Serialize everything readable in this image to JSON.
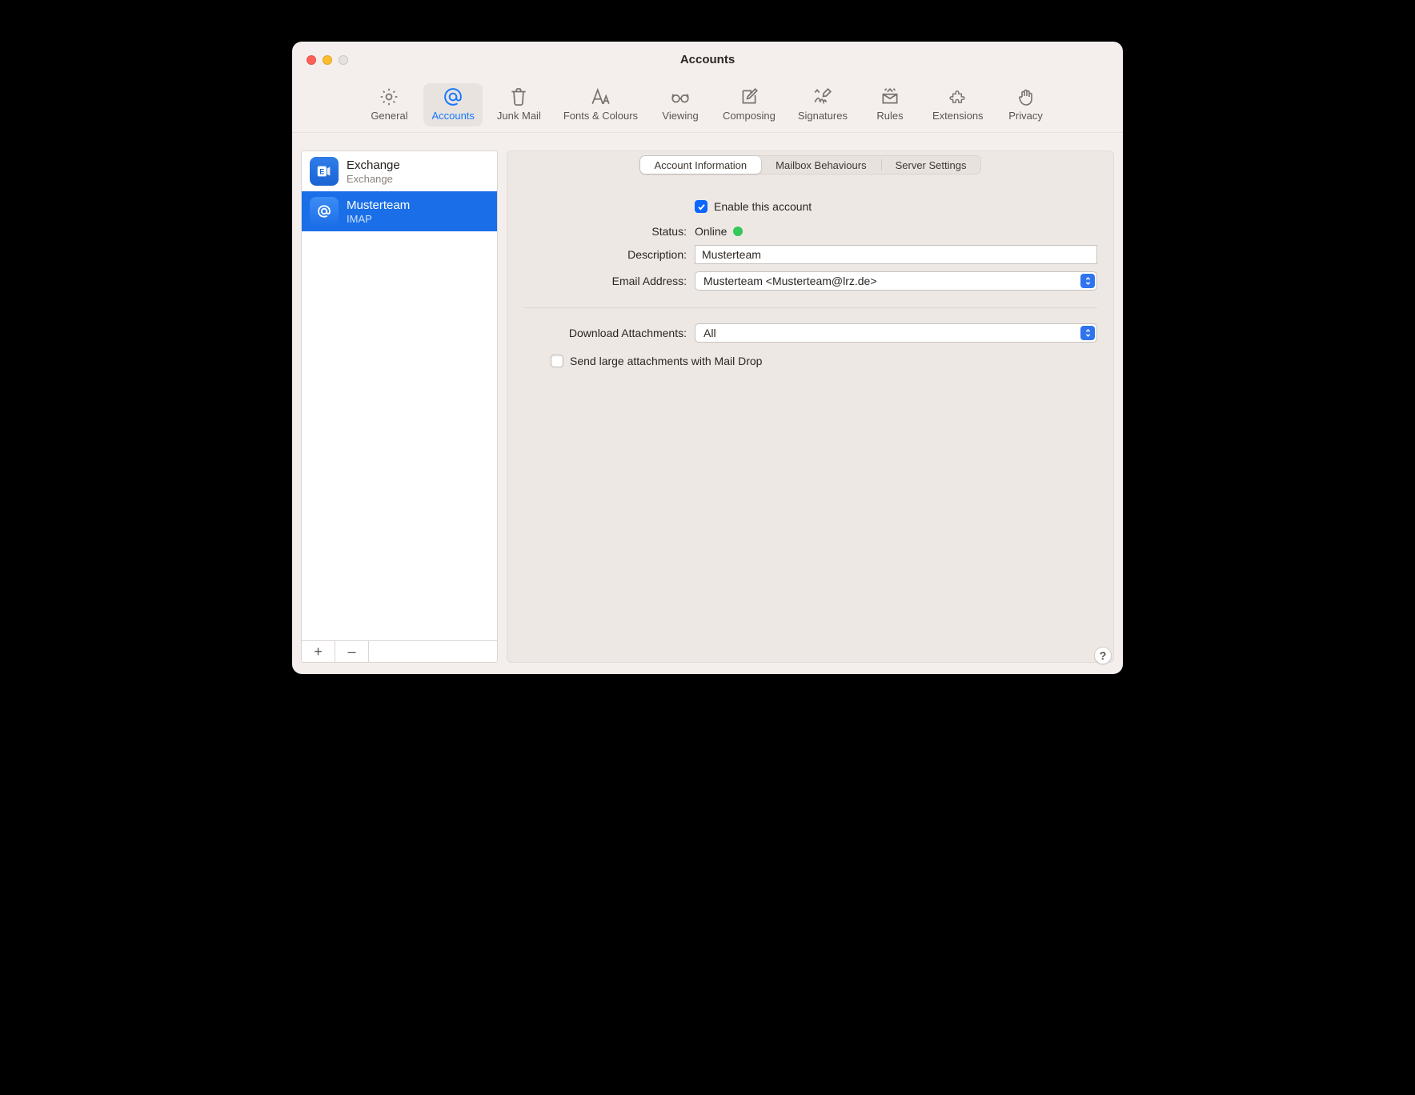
{
  "window": {
    "title": "Accounts"
  },
  "toolbar": {
    "items": [
      {
        "id": "general",
        "label": "General"
      },
      {
        "id": "accounts",
        "label": "Accounts"
      },
      {
        "id": "junk",
        "label": "Junk Mail"
      },
      {
        "id": "fonts",
        "label": "Fonts & Colours"
      },
      {
        "id": "viewing",
        "label": "Viewing"
      },
      {
        "id": "composing",
        "label": "Composing"
      },
      {
        "id": "signatures",
        "label": "Signatures"
      },
      {
        "id": "rules",
        "label": "Rules"
      },
      {
        "id": "extensions",
        "label": "Extensions"
      },
      {
        "id": "privacy",
        "label": "Privacy"
      }
    ],
    "active": "accounts"
  },
  "sidebar": {
    "items": [
      {
        "name": "Exchange",
        "type": "Exchange",
        "kind": "exchange"
      },
      {
        "name": "Musterteam",
        "type": "IMAP",
        "kind": "imap"
      }
    ],
    "selectedIndex": 1,
    "add_label": "+",
    "remove_label": "–"
  },
  "tabs": {
    "items": [
      "Account Information",
      "Mailbox Behaviours",
      "Server Settings"
    ],
    "activeIndex": 0
  },
  "form": {
    "enable_label": "Enable this account",
    "enable_checked": true,
    "status_label": "Status:",
    "status_value": "Online",
    "description_label": "Description:",
    "description_value": "Musterteam",
    "email_label": "Email Address:",
    "email_value": "Musterteam <Musterteam@lrz.de>",
    "download_label": "Download Attachments:",
    "download_value": "All",
    "maildrop_label": "Send large attachments with Mail Drop",
    "maildrop_checked": false
  },
  "help_label": "?"
}
